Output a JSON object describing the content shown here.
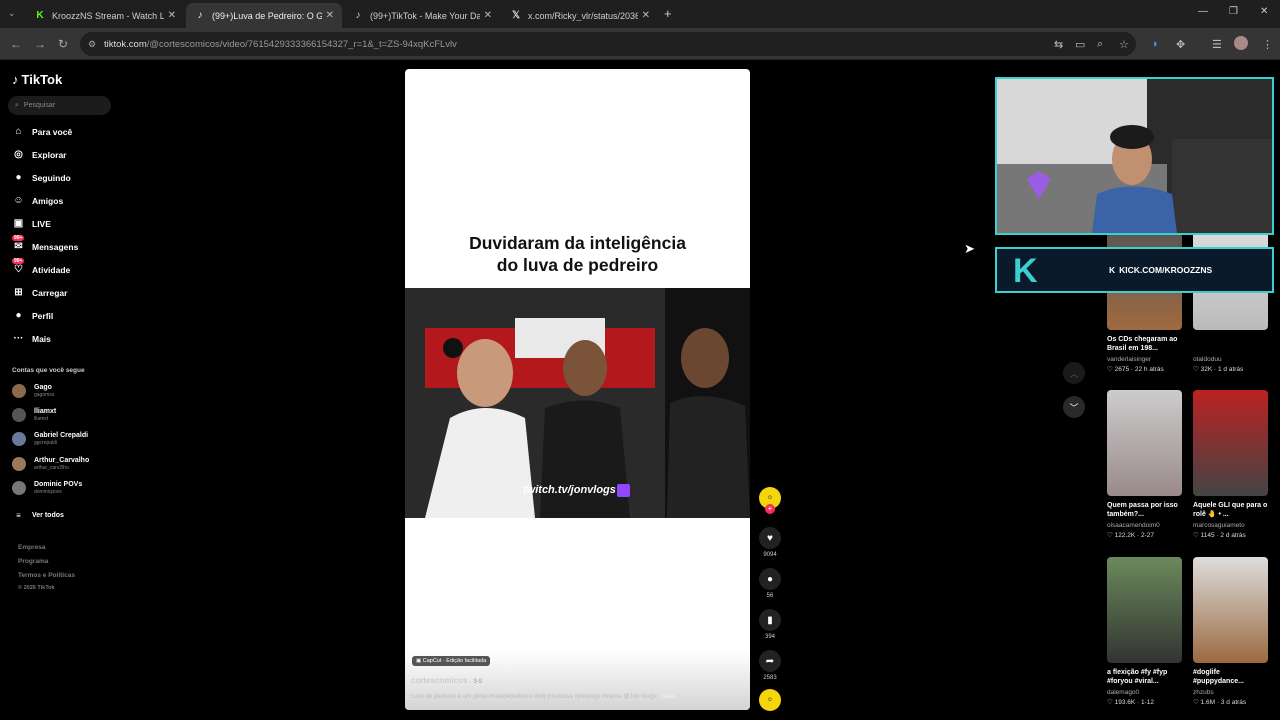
{
  "browser": {
    "tabs": [
      {
        "label": "KroozzNS Stream - Watch Live",
        "icon": "kick-icon"
      },
      {
        "label": "(99+)Luva de Pedreiro: O Gênio",
        "icon": "tiktok-icon"
      },
      {
        "label": "(99+)TikTok - Make Your Day",
        "icon": "tiktok-icon"
      },
      {
        "label": "x.com/Ricky_vlr/status/203608",
        "icon": "x-icon"
      }
    ],
    "url_host": "tiktok.com",
    "url_path": "/@cortescomicos/video/7615429333366154327_r=1&_t=ZS-94xqKcFLvlv"
  },
  "sidebar": {
    "logo": "TikTok",
    "search_placeholder": "Pesquisar",
    "nav": [
      {
        "label": "Para você",
        "icon": "home-icon"
      },
      {
        "label": "Explorar",
        "icon": "compass-icon"
      },
      {
        "label": "Seguindo",
        "icon": "following-icon"
      },
      {
        "label": "Amigos",
        "icon": "friends-icon"
      },
      {
        "label": "LIVE",
        "icon": "live-icon"
      },
      {
        "label": "Mensagens",
        "icon": "messages-icon",
        "badge": "99+"
      },
      {
        "label": "Atividade",
        "icon": "activity-icon",
        "badge": "99+"
      },
      {
        "label": "Carregar",
        "icon": "upload-icon"
      },
      {
        "label": "Perfil",
        "icon": "profile-icon"
      },
      {
        "label": "Mais",
        "icon": "more-icon"
      }
    ],
    "following_title": "Contas que você segue",
    "following": [
      {
        "name": "Gago",
        "user": "gagomss"
      },
      {
        "name": "lliamxt",
        "user": "lliamxt"
      },
      {
        "name": "Gabriel Crepaldi",
        "user": "ggcrepaldi"
      },
      {
        "name": "Arthur_Carvalho",
        "user": "arthur_carv2lho"
      },
      {
        "name": "Dominic POVs",
        "user": "dominicpovs"
      }
    ],
    "see_all": "Ver todos",
    "footer": [
      "Empresa",
      "Programa",
      "Termos e Políticas",
      "© 2026 TikTok"
    ]
  },
  "video": {
    "caption_title": "Duvidaram da inteligência\ndo luva de pedreiro",
    "overlay_text": "twitch.tv/jonvlogs",
    "capcut_label": "CapCut · Edição facilitada",
    "author": "cortescomicos",
    "date": "· 3-9",
    "description": "Luva de pedreiro é um gênio  #luvadepedreiro #bdj #marcove #jonvlogs #meme @Jon Vlogs",
    "more": "mais",
    "actions": {
      "likes": "9094",
      "comments": "56",
      "saves": "394",
      "shares": "2583"
    }
  },
  "overlay": {
    "kick_text": "KICK.COM/KROOZZNS"
  },
  "related": [
    {
      "title": "Os CDs chegaram ao Brasil em 198...",
      "user": "vanderlaisinger",
      "views": "2675",
      "date": "22 h atrás"
    },
    {
      "title": "",
      "user": "otaldoduu",
      "views": "32K",
      "date": "1 d atrás"
    },
    {
      "title": "Quem passa por isso também?...",
      "user": "oisaacamendoim0",
      "views": "122.2K",
      "date": "2-27"
    },
    {
      "title": "Aquele GLI que para o rolê 🤚 • ...",
      "user": "marcosaguiameto",
      "views": "1145",
      "date": "2 d atrás"
    },
    {
      "title": "a flexição #fy #fyp #foryou #viral...",
      "user": "dalemago0",
      "views": "193.6K",
      "date": "1-12"
    },
    {
      "title": "#doglife #puppydance...",
      "user": "zhzubs",
      "views": "1.6M",
      "date": "3 d atrás"
    }
  ],
  "colors": {
    "accent": "#fe2c55",
    "kick": "#53fc18",
    "webcam_border": "#3bd0cf"
  }
}
